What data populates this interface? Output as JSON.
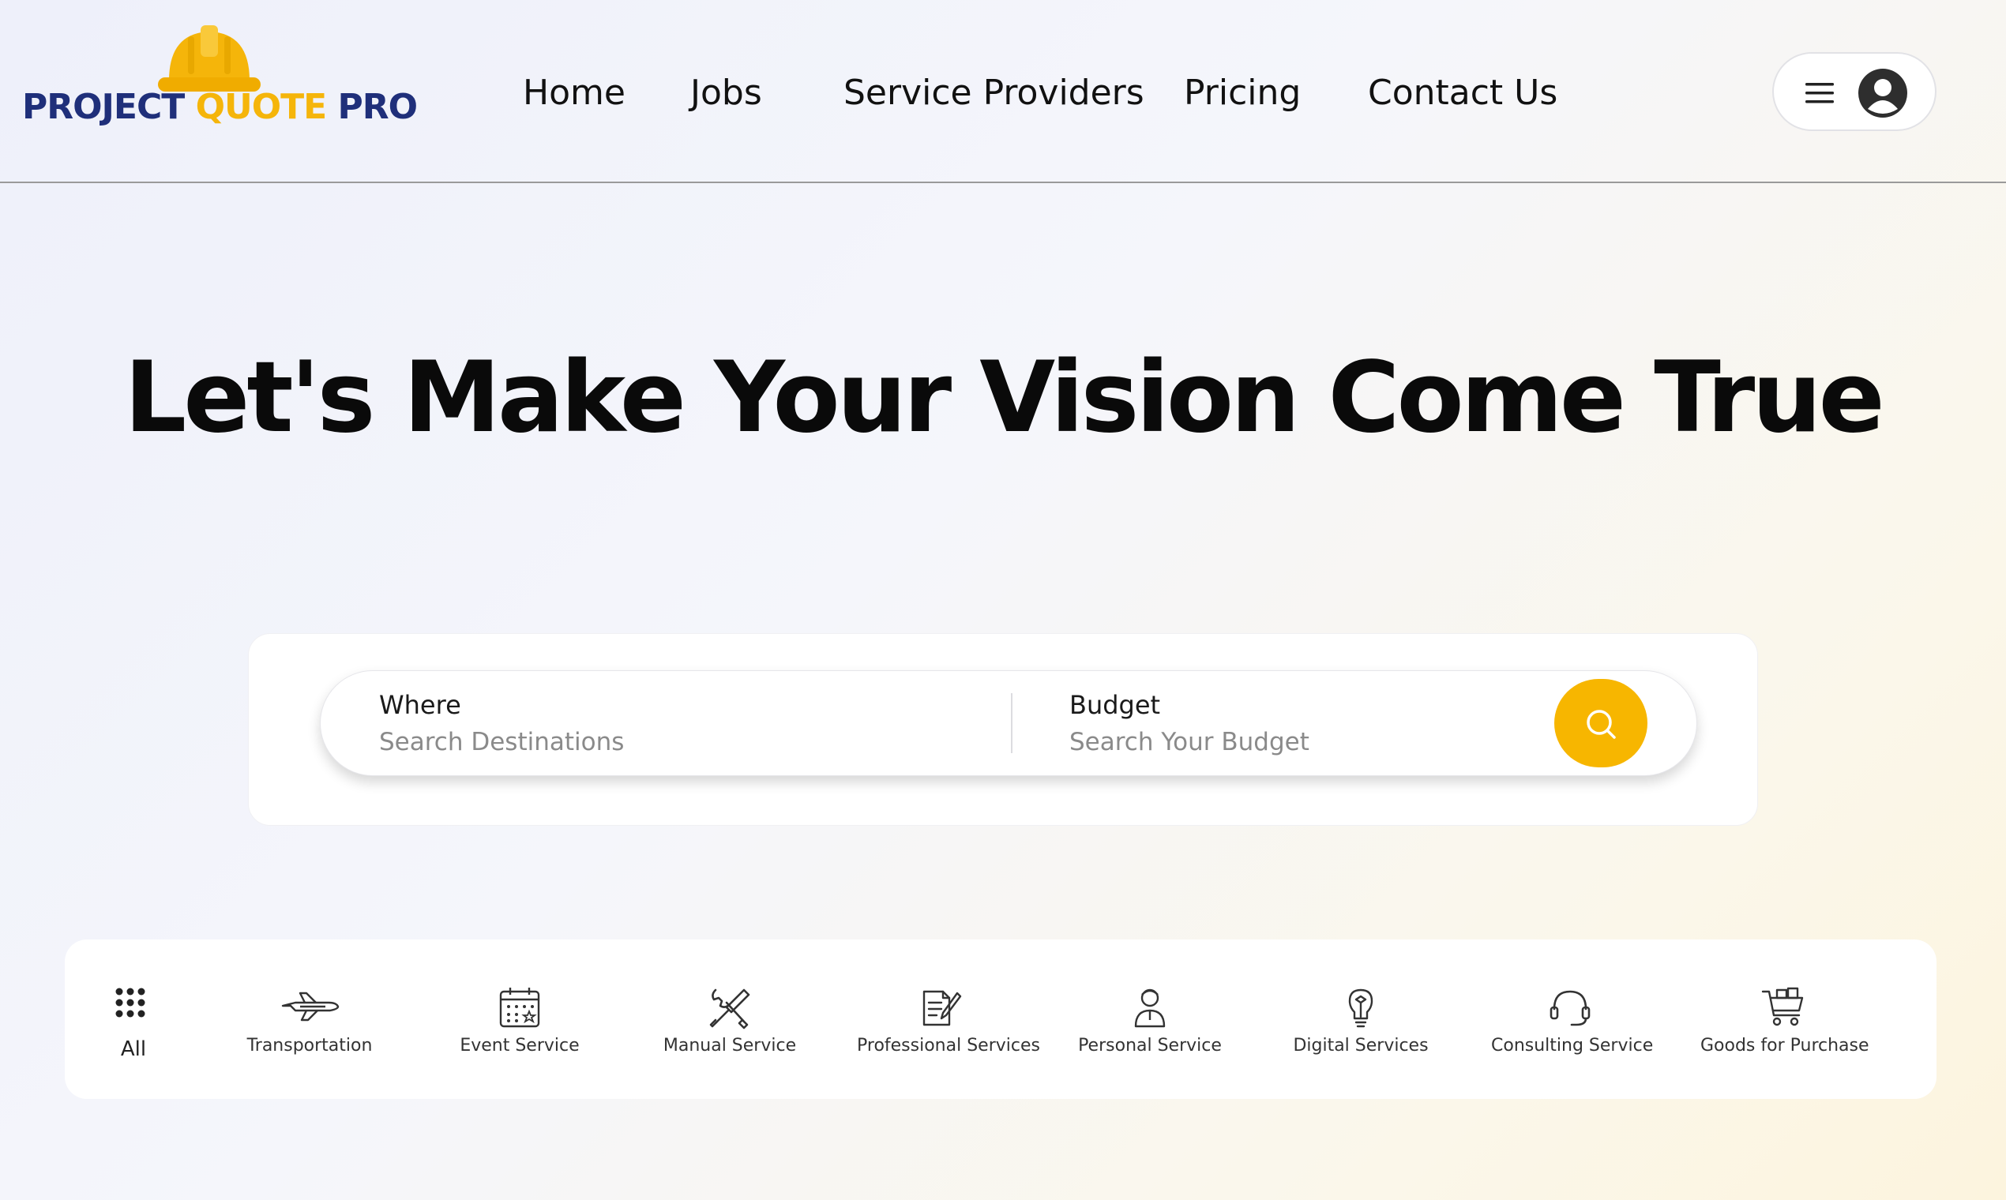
{
  "brand": {
    "name_part1": "PROJECT ",
    "name_part2": "QUOTE",
    "name_part3": " PRO",
    "colors": {
      "navy": "#1f2f7a",
      "yellow": "#f5b50a"
    }
  },
  "nav": {
    "items": [
      {
        "label": "Home"
      },
      {
        "label": "Jobs"
      },
      {
        "label": "Service Providers"
      },
      {
        "label": "Pricing"
      },
      {
        "label": "Contact Us"
      }
    ]
  },
  "header": {
    "menu_icon": "hamburger-menu-icon",
    "avatar_icon": "user-avatar-icon"
  },
  "hero": {
    "title": "Let's Make Your Vision Come True"
  },
  "search": {
    "where_label": "Where",
    "where_placeholder": "Search Destinations",
    "budget_label": "Budget",
    "budget_placeholder": "Search Your Budget",
    "button_icon": "search-icon",
    "accent": "#f7b600"
  },
  "categories": [
    {
      "label": "All",
      "icon": "grid-dots-icon"
    },
    {
      "label": "Transportation",
      "icon": "airplane-icon"
    },
    {
      "label": "Event Service",
      "icon": "calendar-icon"
    },
    {
      "label": "Manual Service",
      "icon": "tools-icon"
    },
    {
      "label": "Professional Services",
      "icon": "document-pen-icon"
    },
    {
      "label": "Personal Service",
      "icon": "person-icon"
    },
    {
      "label": "Digital Services",
      "icon": "lightbulb-icon"
    },
    {
      "label": "Consulting Service",
      "icon": "headset-icon"
    },
    {
      "label": "Goods for Purchase",
      "icon": "cart-icon"
    }
  ]
}
